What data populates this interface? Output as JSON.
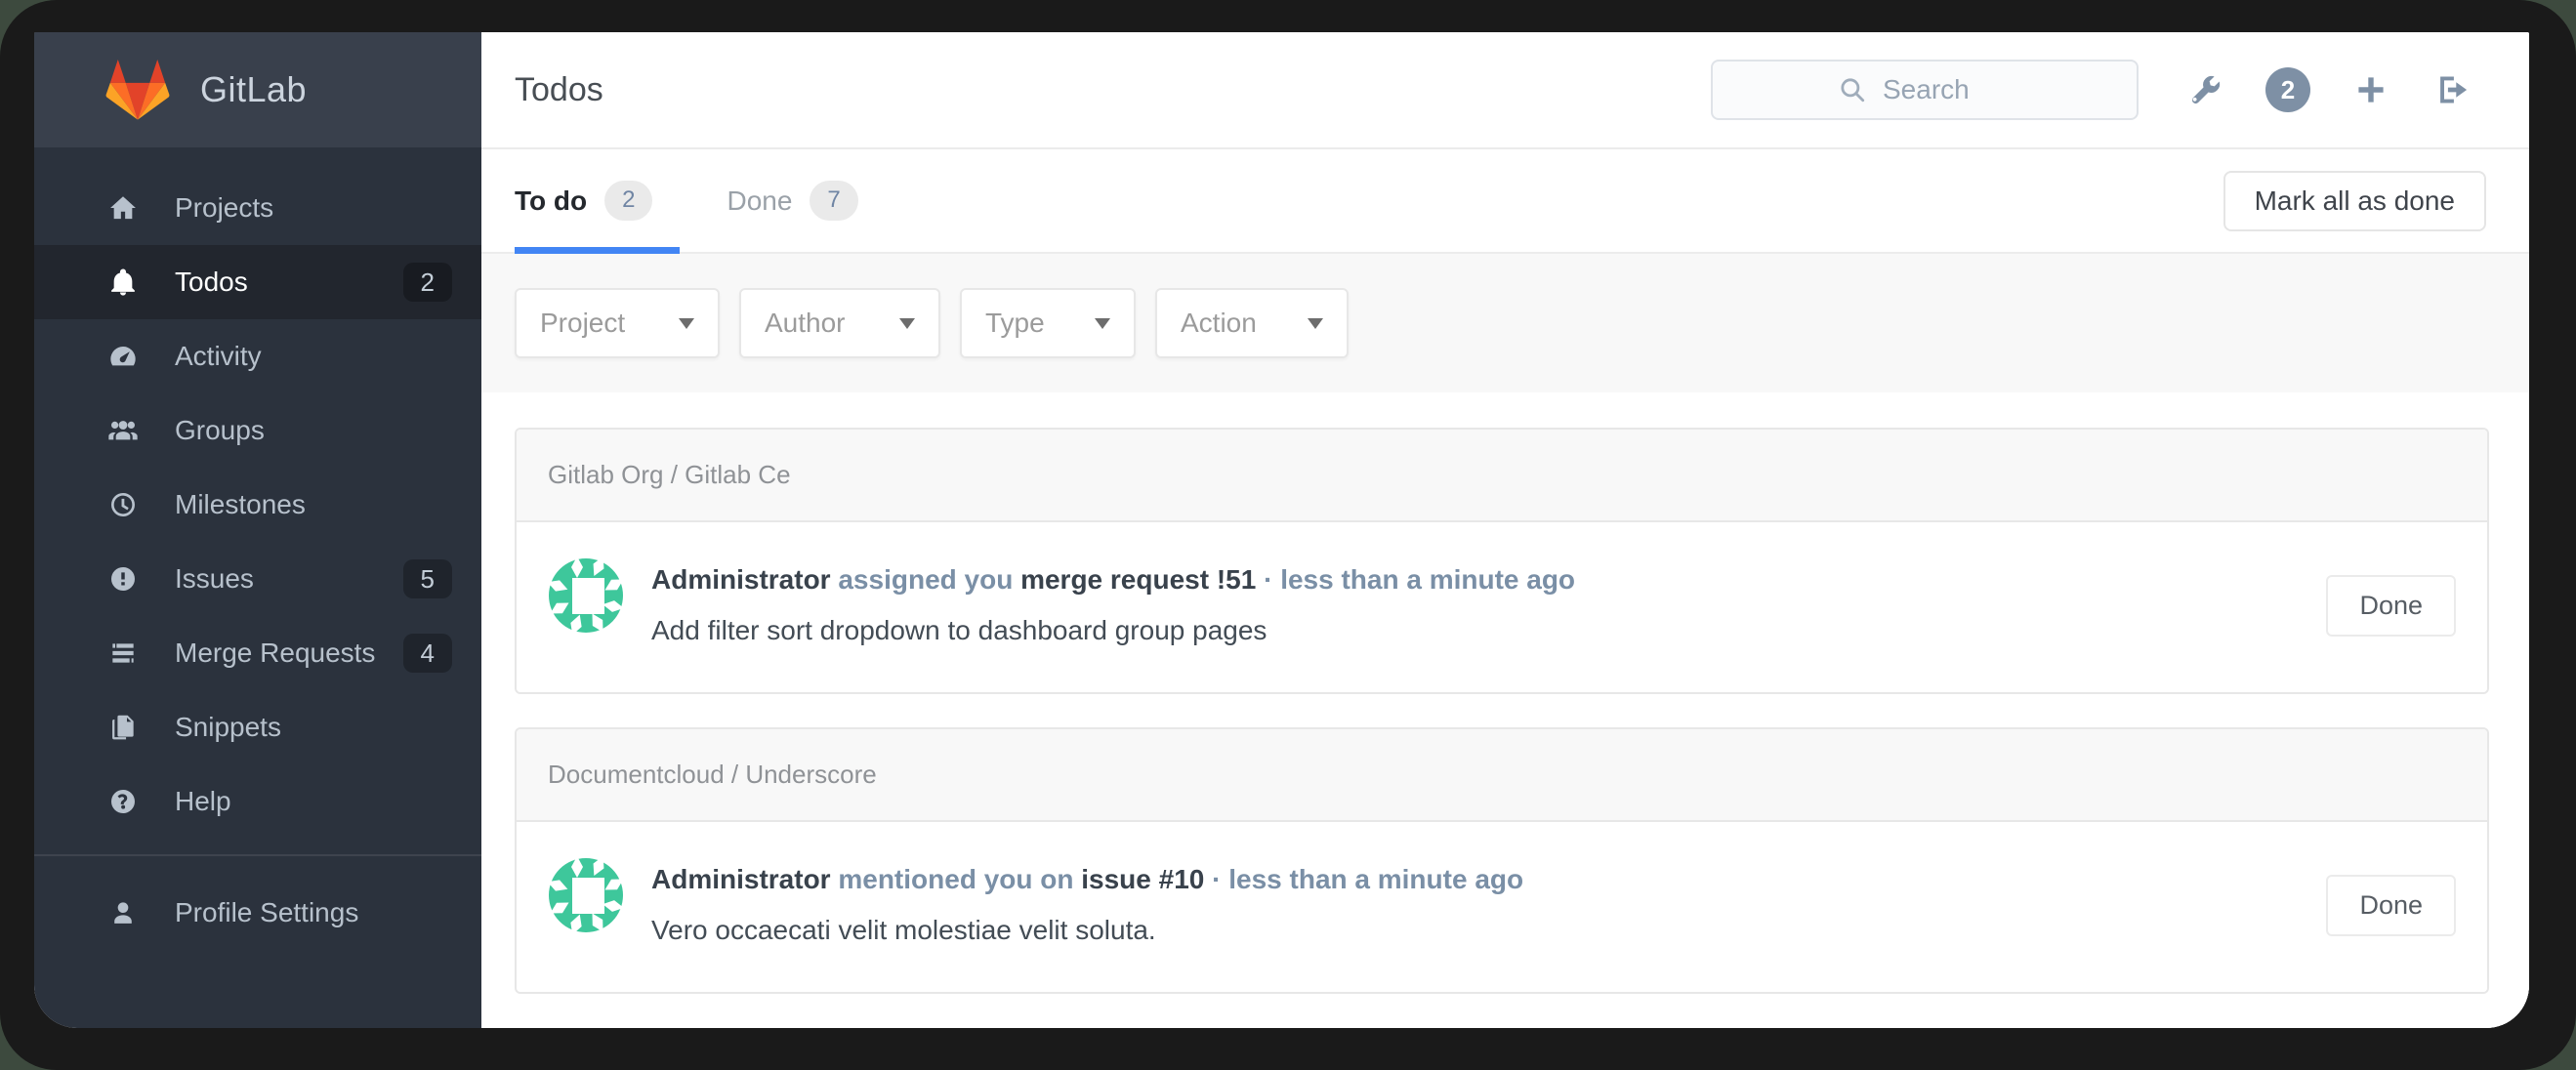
{
  "sidebar": {
    "brand": "GitLab",
    "items": [
      {
        "label": "Projects",
        "icon": "home-icon"
      },
      {
        "label": "Todos",
        "icon": "bell-icon",
        "count": "2",
        "active": true
      },
      {
        "label": "Activity",
        "icon": "dashboard-icon"
      },
      {
        "label": "Groups",
        "icon": "users-icon"
      },
      {
        "label": "Milestones",
        "icon": "clock-icon"
      },
      {
        "label": "Issues",
        "icon": "exclamation-circle-icon",
        "count": "5"
      },
      {
        "label": "Merge Requests",
        "icon": "tasks-icon",
        "count": "4"
      },
      {
        "label": "Snippets",
        "icon": "clipboard-icon"
      },
      {
        "label": "Help",
        "icon": "question-circle-icon"
      }
    ],
    "footer_items": [
      {
        "label": "Profile Settings",
        "icon": "user-icon"
      }
    ]
  },
  "header": {
    "page_title": "Todos",
    "search_placeholder": "Search",
    "todo_count_badge": "2",
    "icons": [
      "wrench-icon",
      "todo-count-badge",
      "plus-icon",
      "sign-out-icon"
    ]
  },
  "tabs": {
    "todo": {
      "label": "To do",
      "count": "2",
      "active": true
    },
    "done": {
      "label": "Done",
      "count": "7"
    },
    "mark_all_label": "Mark all as done"
  },
  "filters": [
    {
      "label": "Project"
    },
    {
      "label": "Author"
    },
    {
      "label": "Type"
    },
    {
      "label": "Action"
    }
  ],
  "todos": {
    "done_label": "Done",
    "groups": [
      {
        "project": "Gitlab Org / Gitlab Ce",
        "item": {
          "author": "Administrator",
          "action": "assigned you",
          "target": "merge request !51",
          "dot": "·",
          "time": "less than a minute ago",
          "body": "Add filter sort dropdown to dashboard group pages"
        }
      },
      {
        "project": "Documentcloud / Underscore",
        "item": {
          "author": "Administrator",
          "action": "mentioned you on",
          "target": "issue #10",
          "dot": "·",
          "time": "less than a minute ago",
          "body": "Vero occaecati velit molestiae velit soluta."
        }
      }
    ]
  },
  "colors": {
    "accent_blue": "#4285f4",
    "avatar_green": "#3ec79b",
    "slate_icon": "#7e90a5",
    "sidebar_bg": "#2b323d",
    "sidebar_header_bg": "#39404c"
  }
}
